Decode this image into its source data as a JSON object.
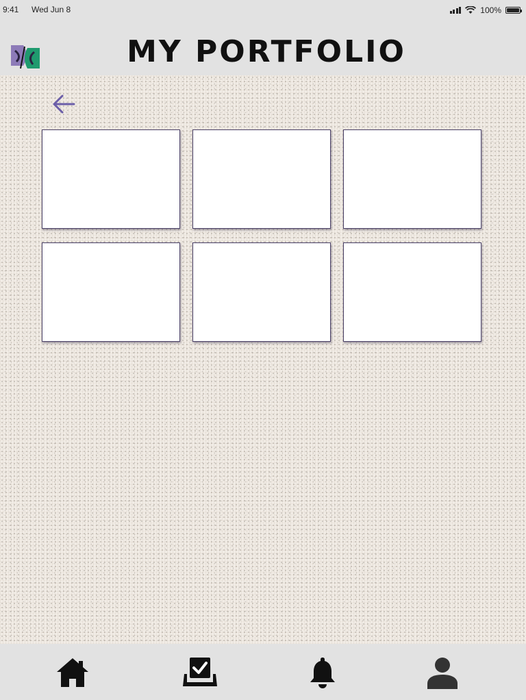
{
  "status_bar": {
    "time": "9:41",
    "date": "Wed Jun 8",
    "battery": "100%"
  },
  "header": {
    "title": "MY PORTFOLIO",
    "logo": "brand-logo"
  },
  "back": {
    "icon": "arrow-left-icon",
    "color": "#6b5ea8"
  },
  "portfolio_tiles": [
    {
      "label": ""
    },
    {
      "label": ""
    },
    {
      "label": ""
    },
    {
      "label": ""
    },
    {
      "label": ""
    },
    {
      "label": ""
    }
  ],
  "bottom_nav": {
    "items": [
      {
        "icon": "home-icon"
      },
      {
        "icon": "checkbox-tray-icon"
      },
      {
        "icon": "bell-icon"
      },
      {
        "icon": "user-icon"
      }
    ]
  },
  "colors": {
    "accent": "#6b5ea8",
    "chrome": "#e2e2e2",
    "canvas": "#efe9e2",
    "icon": "#111111"
  }
}
